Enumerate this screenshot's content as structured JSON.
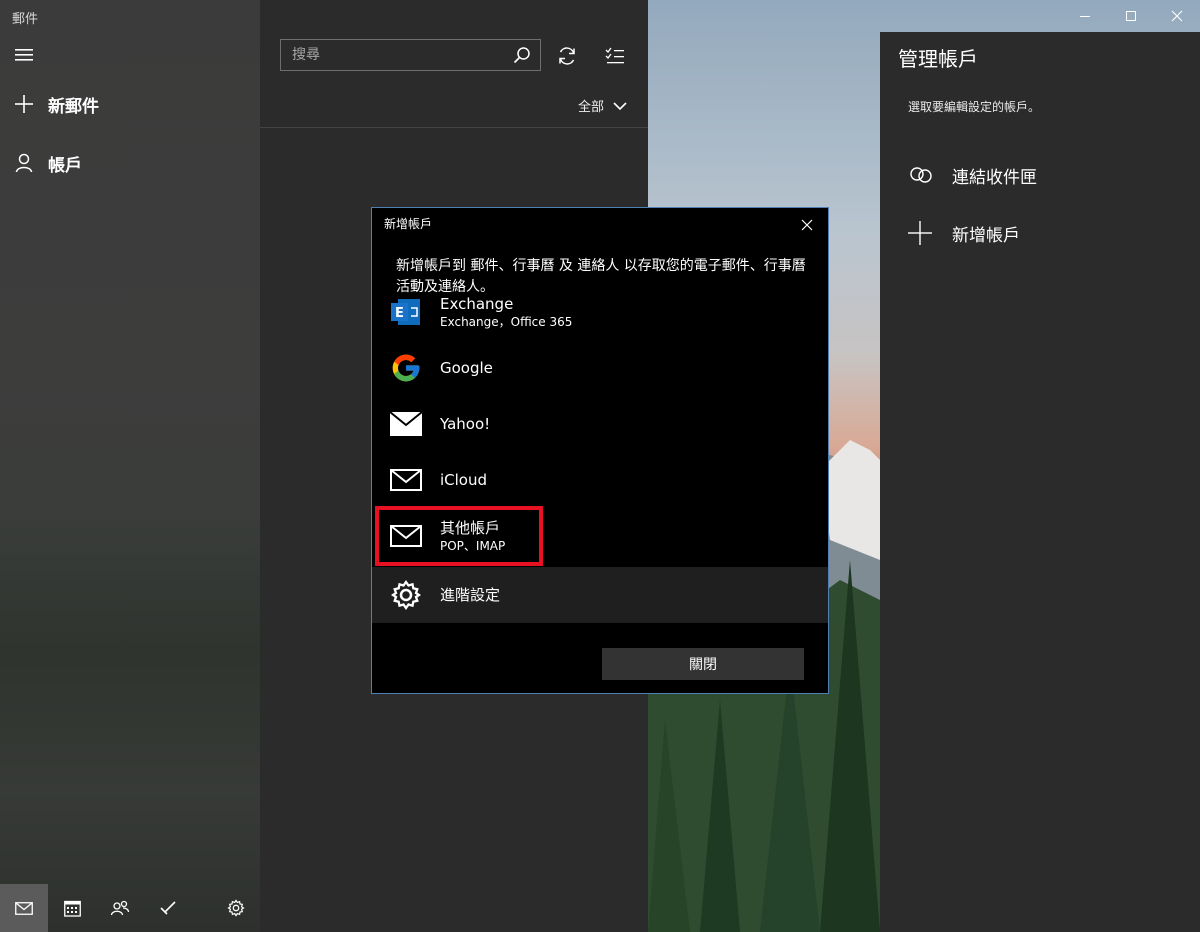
{
  "app": {
    "title": "郵件"
  },
  "nav": {
    "new_mail": "新郵件",
    "accounts": "帳戶"
  },
  "list": {
    "search_placeholder": "搜尋",
    "filter_label": "全部"
  },
  "manage": {
    "title": "管理帳戶",
    "subtitle": "選取要編輯設定的帳戶。",
    "link_inboxes": "連結收件匣",
    "add_account": "新增帳戶"
  },
  "dialog": {
    "title": "新增帳戶",
    "description": "新增帳戶到 郵件、行事曆 及 連絡人 以存取您的電子郵件、行事曆活動及連絡人。",
    "accounts": [
      {
        "name": "Exchange",
        "desc": "Exchange，Office 365",
        "icon": "exchange-icon"
      },
      {
        "name": "Google",
        "desc": "",
        "icon": "google-icon"
      },
      {
        "name": "Yahoo!",
        "desc": "",
        "icon": "mail-filled-icon"
      },
      {
        "name": "iCloud",
        "desc": "",
        "icon": "mail-outline-icon"
      },
      {
        "name": "其他帳戶",
        "desc": "POP、IMAP",
        "icon": "mail-outline-icon"
      },
      {
        "name": "進階設定",
        "desc": "",
        "icon": "gear-icon"
      }
    ],
    "close_button": "關閉"
  },
  "colors": {
    "highlight": "#e81123",
    "dialog_border": "#4f7fb3",
    "exchange_blue": "#0f6cbd"
  }
}
